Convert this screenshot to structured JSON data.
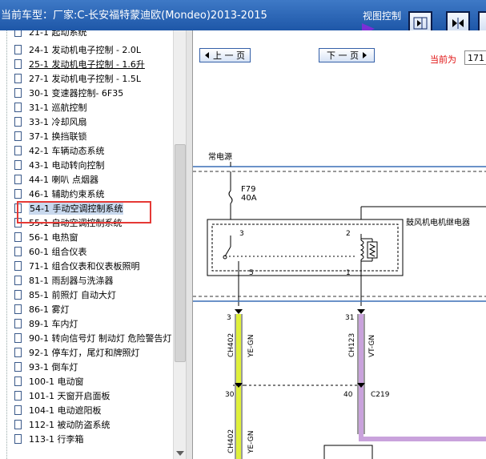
{
  "titlebar": {
    "title": "当前车型：厂家:C-长安福特蒙迪欧(Mondeo)2013-2015",
    "view_control_label": "视图控制"
  },
  "tree": {
    "top_partial": "21-1 起动系统",
    "items": [
      {
        "label": "24-1 发动机电子控制 - 2.0L"
      },
      {
        "label": "25-1 发动机电子控制 - 1.6升"
      },
      {
        "label": "27-1 发动机电子控制 - 1.5L"
      },
      {
        "label": "30-1 变速器控制- 6F35"
      },
      {
        "label": "31-1 巡航控制"
      },
      {
        "label": "33-1 冷却风扇"
      },
      {
        "label": "37-1 换挡联锁"
      },
      {
        "label": "42-1 车辆动态系统"
      },
      {
        "label": "43-1 电动转向控制"
      },
      {
        "label": "44-1 喇叭 点烟器"
      },
      {
        "label": "46-1 辅助约束系统"
      },
      {
        "label": "54-1 手动空调控制系统"
      },
      {
        "label": "55-1 自动空调控制系统"
      },
      {
        "label": "56-1 电热窗"
      },
      {
        "label": "60-1 组合仪表"
      },
      {
        "label": "71-1 组合仪表和仪表板照明"
      },
      {
        "label": "81-1 雨刮器与洗涤器"
      },
      {
        "label": "85-1 前照灯 自动大灯"
      },
      {
        "label": "86-1 雾灯"
      },
      {
        "label": "89-1 车内灯"
      },
      {
        "label": "90-1 转向信号灯 制动灯 危险警告灯"
      },
      {
        "label": "92-1 停车灯，尾灯和牌照灯"
      },
      {
        "label": "93-1 倒车灯"
      },
      {
        "label": "100-1 电动窗"
      },
      {
        "label": "101-1 天窗开启面板"
      },
      {
        "label": "104-1 电动遮阳板"
      },
      {
        "label": "112-1 被动防盗系统"
      },
      {
        "label": "113-1 行李箱"
      }
    ]
  },
  "pager": {
    "prev_label": "上 一 页",
    "next_label": "下 一 页",
    "current_label": "当前为",
    "current_value": "171"
  },
  "diagram": {
    "power_label": "常电源",
    "fuse_id": "F79",
    "fuse_rating": "40A",
    "relay_name": "鼓风机电机继电器",
    "relay_pins": {
      "p3": "3",
      "p2": "2",
      "p5": "5",
      "p1": "1"
    },
    "wire_left": {
      "pin_top": "3",
      "circuit": "CH402",
      "color_code": "YE-GN",
      "pin_mid": "30"
    },
    "wire_right": {
      "pin_top": "31",
      "circuit": "CH123",
      "color_code": "VT-GN",
      "pin_mid": "40",
      "connector": "C219"
    },
    "colors": {
      "wire_left": "#dff03a",
      "wire_right": "#c9a2dc"
    }
  }
}
